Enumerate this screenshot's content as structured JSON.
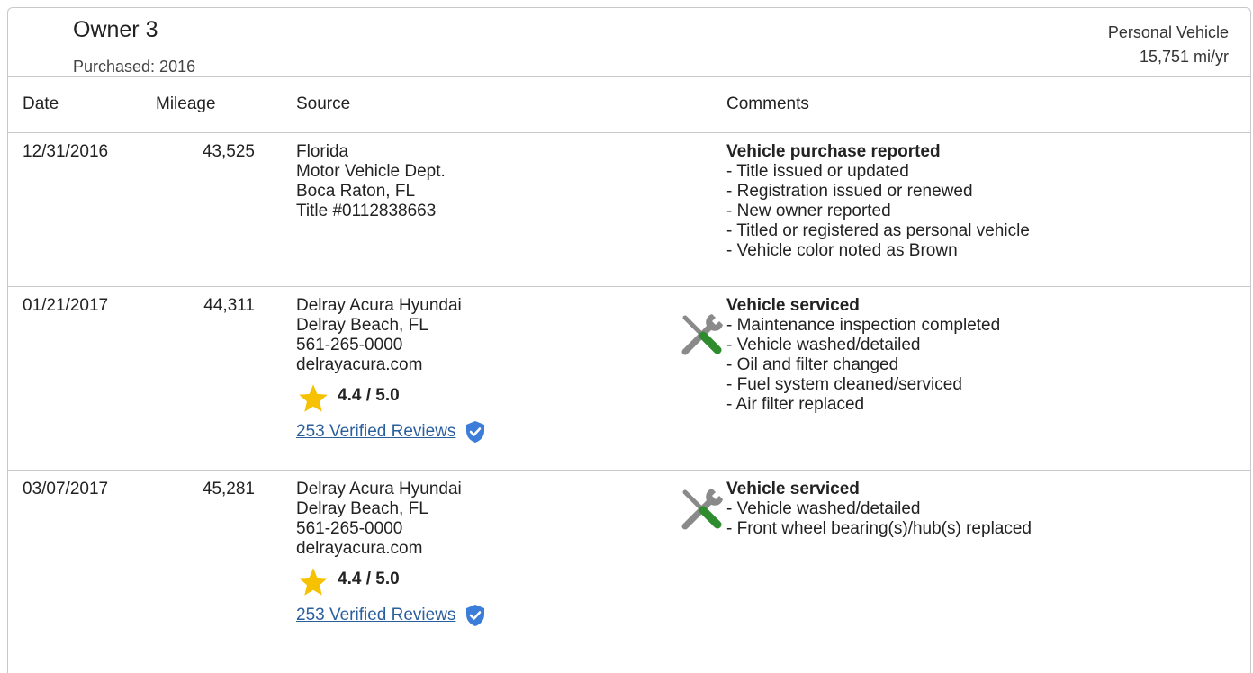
{
  "owner": {
    "title": "Owner 3",
    "purchased": "Purchased: 2016",
    "vehicle_type": "Personal Vehicle",
    "miles_per_year": "15,751 mi/yr"
  },
  "columns": {
    "date": "Date",
    "mileage": "Mileage",
    "source": "Source",
    "comments": "Comments"
  },
  "rows": [
    {
      "date": "12/31/2016",
      "mileage": "43,525",
      "source": [
        "Florida",
        "Motor Vehicle Dept.",
        "Boca Raton, FL",
        "Title #0112838663"
      ],
      "comment_title": "Vehicle purchase reported",
      "comments": [
        "- Title issued or updated",
        "- Registration issued or renewed",
        "- New owner reported",
        "- Titled or registered as personal vehicle",
        "- Vehicle color noted as Brown"
      ]
    },
    {
      "date": "01/21/2017",
      "mileage": "44,311",
      "source": [
        "Delray Acura Hyundai",
        "Delray Beach, FL",
        "561-265-0000",
        "delrayacura.com"
      ],
      "rating": "4.4 / 5.0",
      "reviews": "253 Verified Reviews",
      "comment_title": "Vehicle serviced",
      "comments": [
        "- Maintenance inspection completed",
        "- Vehicle washed/detailed",
        "- Oil and filter changed",
        "- Fuel system cleaned/serviced",
        "- Air filter replaced"
      ]
    },
    {
      "date": "03/07/2017",
      "mileage": "45,281",
      "source": [
        "Delray Acura Hyundai",
        "Delray Beach, FL",
        "561-265-0000",
        "delrayacura.com"
      ],
      "rating": "4.4 / 5.0",
      "reviews": "253 Verified Reviews",
      "comment_title": "Vehicle serviced",
      "comments": [
        "- Vehicle washed/detailed",
        "- Front wheel bearing(s)/hub(s) replaced"
      ]
    }
  ],
  "colors": {
    "border": "#c8c8c8",
    "link": "#2a5f9e",
    "star": "#f6c200",
    "shield": "#3b7dd8",
    "wrench_green": "#2e8b2e",
    "tool_gray": "#8a8a8a"
  },
  "icons": {
    "rating": "star-icon",
    "verified": "verified-shield-icon",
    "service": "wrench-screwdriver-icon"
  }
}
